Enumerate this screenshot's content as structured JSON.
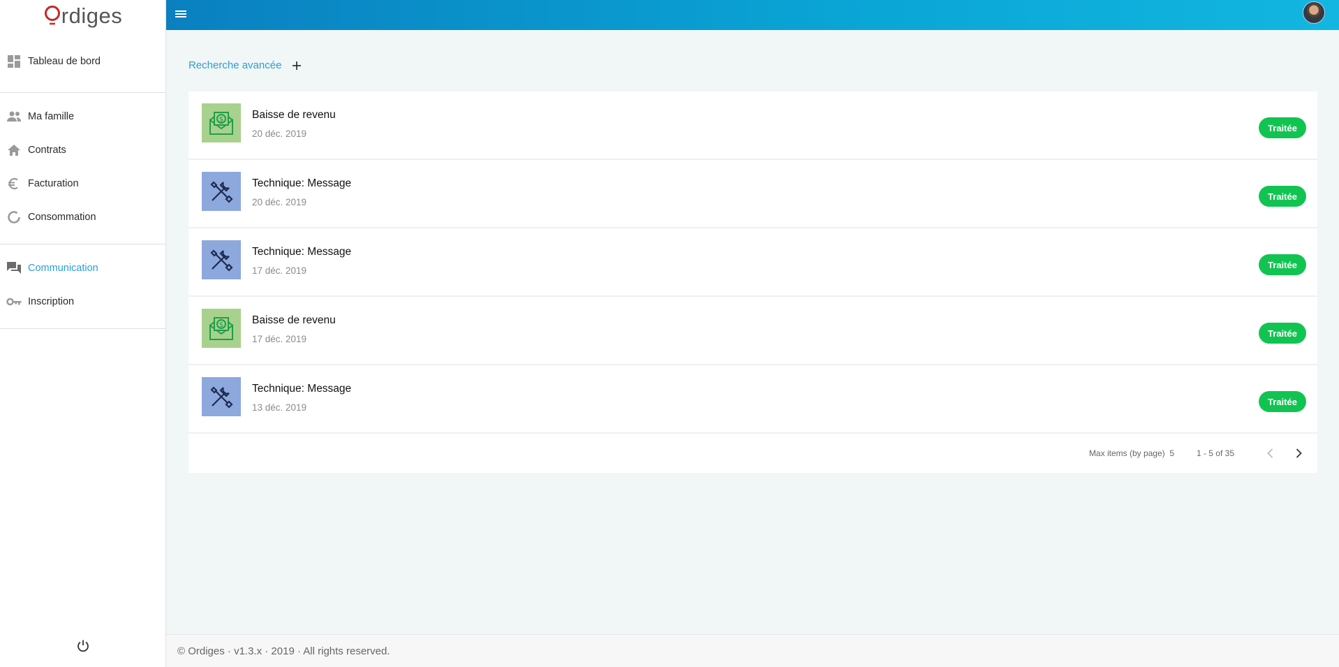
{
  "app": {
    "logo_first": "Q",
    "logo_rest": "rdiges"
  },
  "sidebar": {
    "groups": [
      {
        "items": [
          {
            "label": "Tableau de bord",
            "icon": "dashboard-icon"
          }
        ]
      },
      {
        "items": [
          {
            "label": "Ma famille",
            "icon": "people-icon"
          },
          {
            "label": "Contrats",
            "icon": "home-icon"
          },
          {
            "label": "Facturation",
            "icon": "euro-icon"
          },
          {
            "label": "Consommation",
            "icon": "donut-icon"
          }
        ]
      },
      {
        "items": [
          {
            "label": "Communication",
            "icon": "chat-icon",
            "active": true
          },
          {
            "label": "Inscription",
            "icon": "key-icon"
          }
        ]
      }
    ],
    "power_icon": "power-icon"
  },
  "main": {
    "advanced_search": "Recherche avancée",
    "requests": [
      {
        "title": "Baisse de revenu",
        "date": "20 déc. 2019",
        "status": "Traitée",
        "kind": "money",
        "icon": "money-envelope-icon"
      },
      {
        "title": "Technique: Message",
        "date": "20 déc. 2019",
        "status": "Traitée",
        "kind": "tech",
        "icon": "tools-icon"
      },
      {
        "title": "Technique: Message",
        "date": "17 déc. 2019",
        "status": "Traitée",
        "kind": "tech",
        "icon": "tools-icon"
      },
      {
        "title": "Baisse de revenu",
        "date": "17 déc. 2019",
        "status": "Traitée",
        "kind": "money",
        "icon": "money-envelope-icon"
      },
      {
        "title": "Technique: Message",
        "date": "13 déc. 2019",
        "status": "Traitée",
        "kind": "tech",
        "icon": "tools-icon"
      }
    ],
    "pager": {
      "max_items_label": "Max items (by page)",
      "max_items_value": "5",
      "range": "1 - 5 of 35"
    }
  },
  "footer": {
    "text": "© Ordiges · v1.3.x · 2019 · All rights reserved."
  },
  "colors": {
    "accent": "#2a9fd6",
    "status_green": "#11c451",
    "money_tile": "#a8d18d",
    "tech_tile": "#8da8dc"
  }
}
